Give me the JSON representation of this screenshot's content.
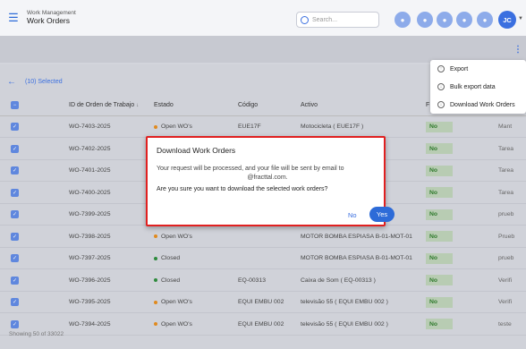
{
  "header": {
    "section": "Work Management",
    "title": "Work Orders",
    "search_placeholder": "Search...",
    "avatar_initials": "JC"
  },
  "toolbar": {
    "selected_label": "(10) Selected"
  },
  "menu": {
    "items": [
      "Export",
      "Bulk export data",
      "Download Work Orders"
    ]
  },
  "table": {
    "columns": [
      "ID de Orden de Trabajo",
      "Estado",
      "Código",
      "Activo",
      "F"
    ],
    "rows": [
      {
        "id": "WO-7403-2025",
        "estado": "Open WO's",
        "estado_color": "#e08a1e",
        "codigo": "EUE17F",
        "activo": "Motocicleta ( EUE17F )",
        "flag": "No",
        "end": "Mant"
      },
      {
        "id": "WO-7402-2025",
        "estado": "",
        "estado_color": "",
        "codigo": "",
        "activo": "",
        "flag": "No",
        "end": "Tarea"
      },
      {
        "id": "WO-7401-2025",
        "estado": "",
        "estado_color": "",
        "codigo": "",
        "activo": "",
        "flag": "No",
        "end": "Tarea"
      },
      {
        "id": "WO-7400-2025",
        "estado": "",
        "estado_color": "",
        "codigo": "",
        "activo": "",
        "flag": "No",
        "end": "Tarea"
      },
      {
        "id": "WO-7399-2025",
        "estado": "",
        "estado_color": "",
        "codigo": "",
        "activo": "",
        "flag": "No",
        "end": "prueb"
      },
      {
        "id": "WO-7398-2025",
        "estado": "Open WO's",
        "estado_color": "#e08a1e",
        "codigo": "",
        "activo": "MOTOR BOMBA ESPIASA B-01-MOT-01",
        "flag": "No",
        "end": "Prueb"
      },
      {
        "id": "WO-7397-2025",
        "estado": "Closed",
        "estado_color": "#2d8a3c",
        "codigo": "",
        "activo": "MOTOR BOMBA ESPIASA B-01-MOT-01",
        "flag": "No",
        "end": "prueb"
      },
      {
        "id": "WO-7396-2025",
        "estado": "Closed",
        "estado_color": "#2d8a3c",
        "codigo": "EQ-00313",
        "activo": "Caixa de Som ( EQ-00313 )",
        "flag": "No",
        "end": "Verifi"
      },
      {
        "id": "WO-7395-2025",
        "estado": "Open WO's",
        "estado_color": "#e08a1e",
        "codigo": "EQUI EMBU 002",
        "activo": "televisão 55 ( EQUI EMBU 002 )",
        "flag": "No",
        "end": "Verifi"
      },
      {
        "id": "WO-7394-2025",
        "estado": "Open WO's",
        "estado_color": "#e08a1e",
        "codigo": "EQUI EMBU 002",
        "activo": "televisão 55 ( EQUI EMBU 002 )",
        "flag": "No",
        "end": "teste"
      }
    ]
  },
  "footer": {
    "showing": "Showing 50 of 33022"
  },
  "modal": {
    "title": "Download Work Orders",
    "body_line1": "Your request will be processed, and your file will be sent by email to",
    "body_line2": "@fracttal.com.",
    "question": "Are you sure you want to download the selected work orders?",
    "no_label": "No",
    "yes_label": "Yes"
  }
}
